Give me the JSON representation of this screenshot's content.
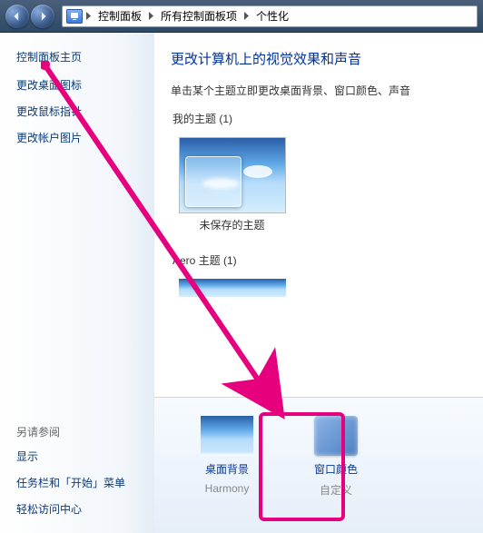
{
  "nav": {
    "breadcrumb": [
      "控制面板",
      "所有控制面板项",
      "个性化"
    ]
  },
  "sidebar": {
    "home": "控制面板主页",
    "links": [
      "更改桌面图标",
      "更改鼠标指针",
      "更改帐户图片"
    ],
    "see_also_title": "另请参阅",
    "see_also": [
      "显示",
      "任务栏和「开始」菜单",
      "轻松访问中心"
    ]
  },
  "content": {
    "heading": "更改计算机上的视觉效果和声音",
    "desc": "单击某个主题立即更改桌面背景、窗口颜色、声音",
    "my_themes_title": "我的主题 (1)",
    "unsaved_theme_label": "未保存的主题",
    "aero_title": "Aero 主题 (1)"
  },
  "bottombar": {
    "bg_link": "桌面背景",
    "bg_sub": "Harmony",
    "color_link": "窗口颜色",
    "color_sub": "自定义"
  },
  "colors": {
    "accent": "#e6007e"
  }
}
